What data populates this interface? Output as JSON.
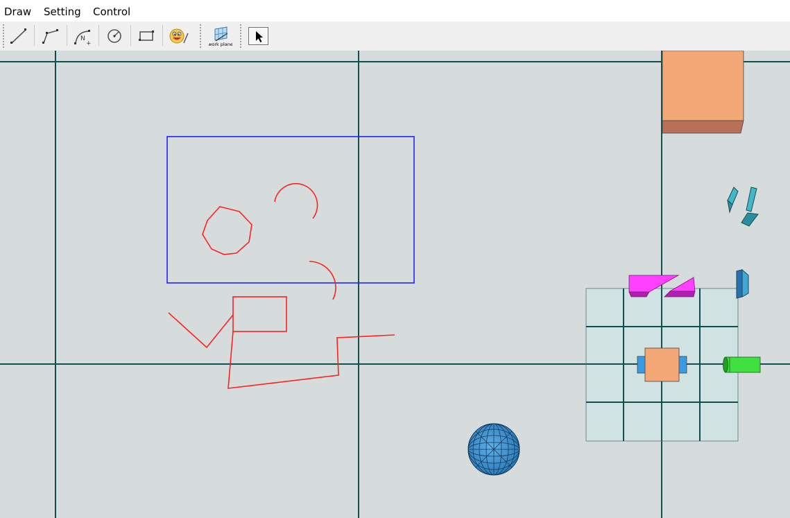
{
  "menu": {
    "items": [
      {
        "label": "Draw"
      },
      {
        "label": "Setting"
      },
      {
        "label": "Control"
      }
    ]
  },
  "toolbar": {
    "tools": [
      {
        "name": "line-tool",
        "icon": "line-icon"
      },
      {
        "name": "polyline-tool",
        "icon": "polyline-icon"
      },
      {
        "name": "nurbs-curve-tool",
        "icon": "nurbs-curve-icon",
        "badge": "N"
      },
      {
        "name": "circle-tool",
        "icon": "circle-icon"
      },
      {
        "name": "rectangle-tool",
        "icon": "rectangle-icon"
      },
      {
        "name": "emoji-tool",
        "icon": "smiley-icon"
      },
      {
        "name": "work-plane-tool",
        "icon": "work-plane-icon",
        "label": "work plane"
      },
      {
        "name": "select-tool",
        "icon": "cursor-arrow-icon"
      }
    ]
  },
  "viewport": {
    "background": "#d6dcdc",
    "axis_color": "#0f4f4f",
    "sketch_color": "#ff2020",
    "selection_box_color": "#2020ff",
    "objects": [
      {
        "name": "orange-box",
        "color": "#f4a878"
      },
      {
        "name": "magenta-wedge",
        "color": "#ff40ff"
      },
      {
        "name": "cyan-profiles",
        "color": "#40b8c8"
      },
      {
        "name": "green-cylinder",
        "color": "#40e040"
      },
      {
        "name": "blue-sphere",
        "color": "#3a8ed0"
      },
      {
        "name": "work-plane-grid",
        "color": "#d0e2e2"
      }
    ]
  }
}
